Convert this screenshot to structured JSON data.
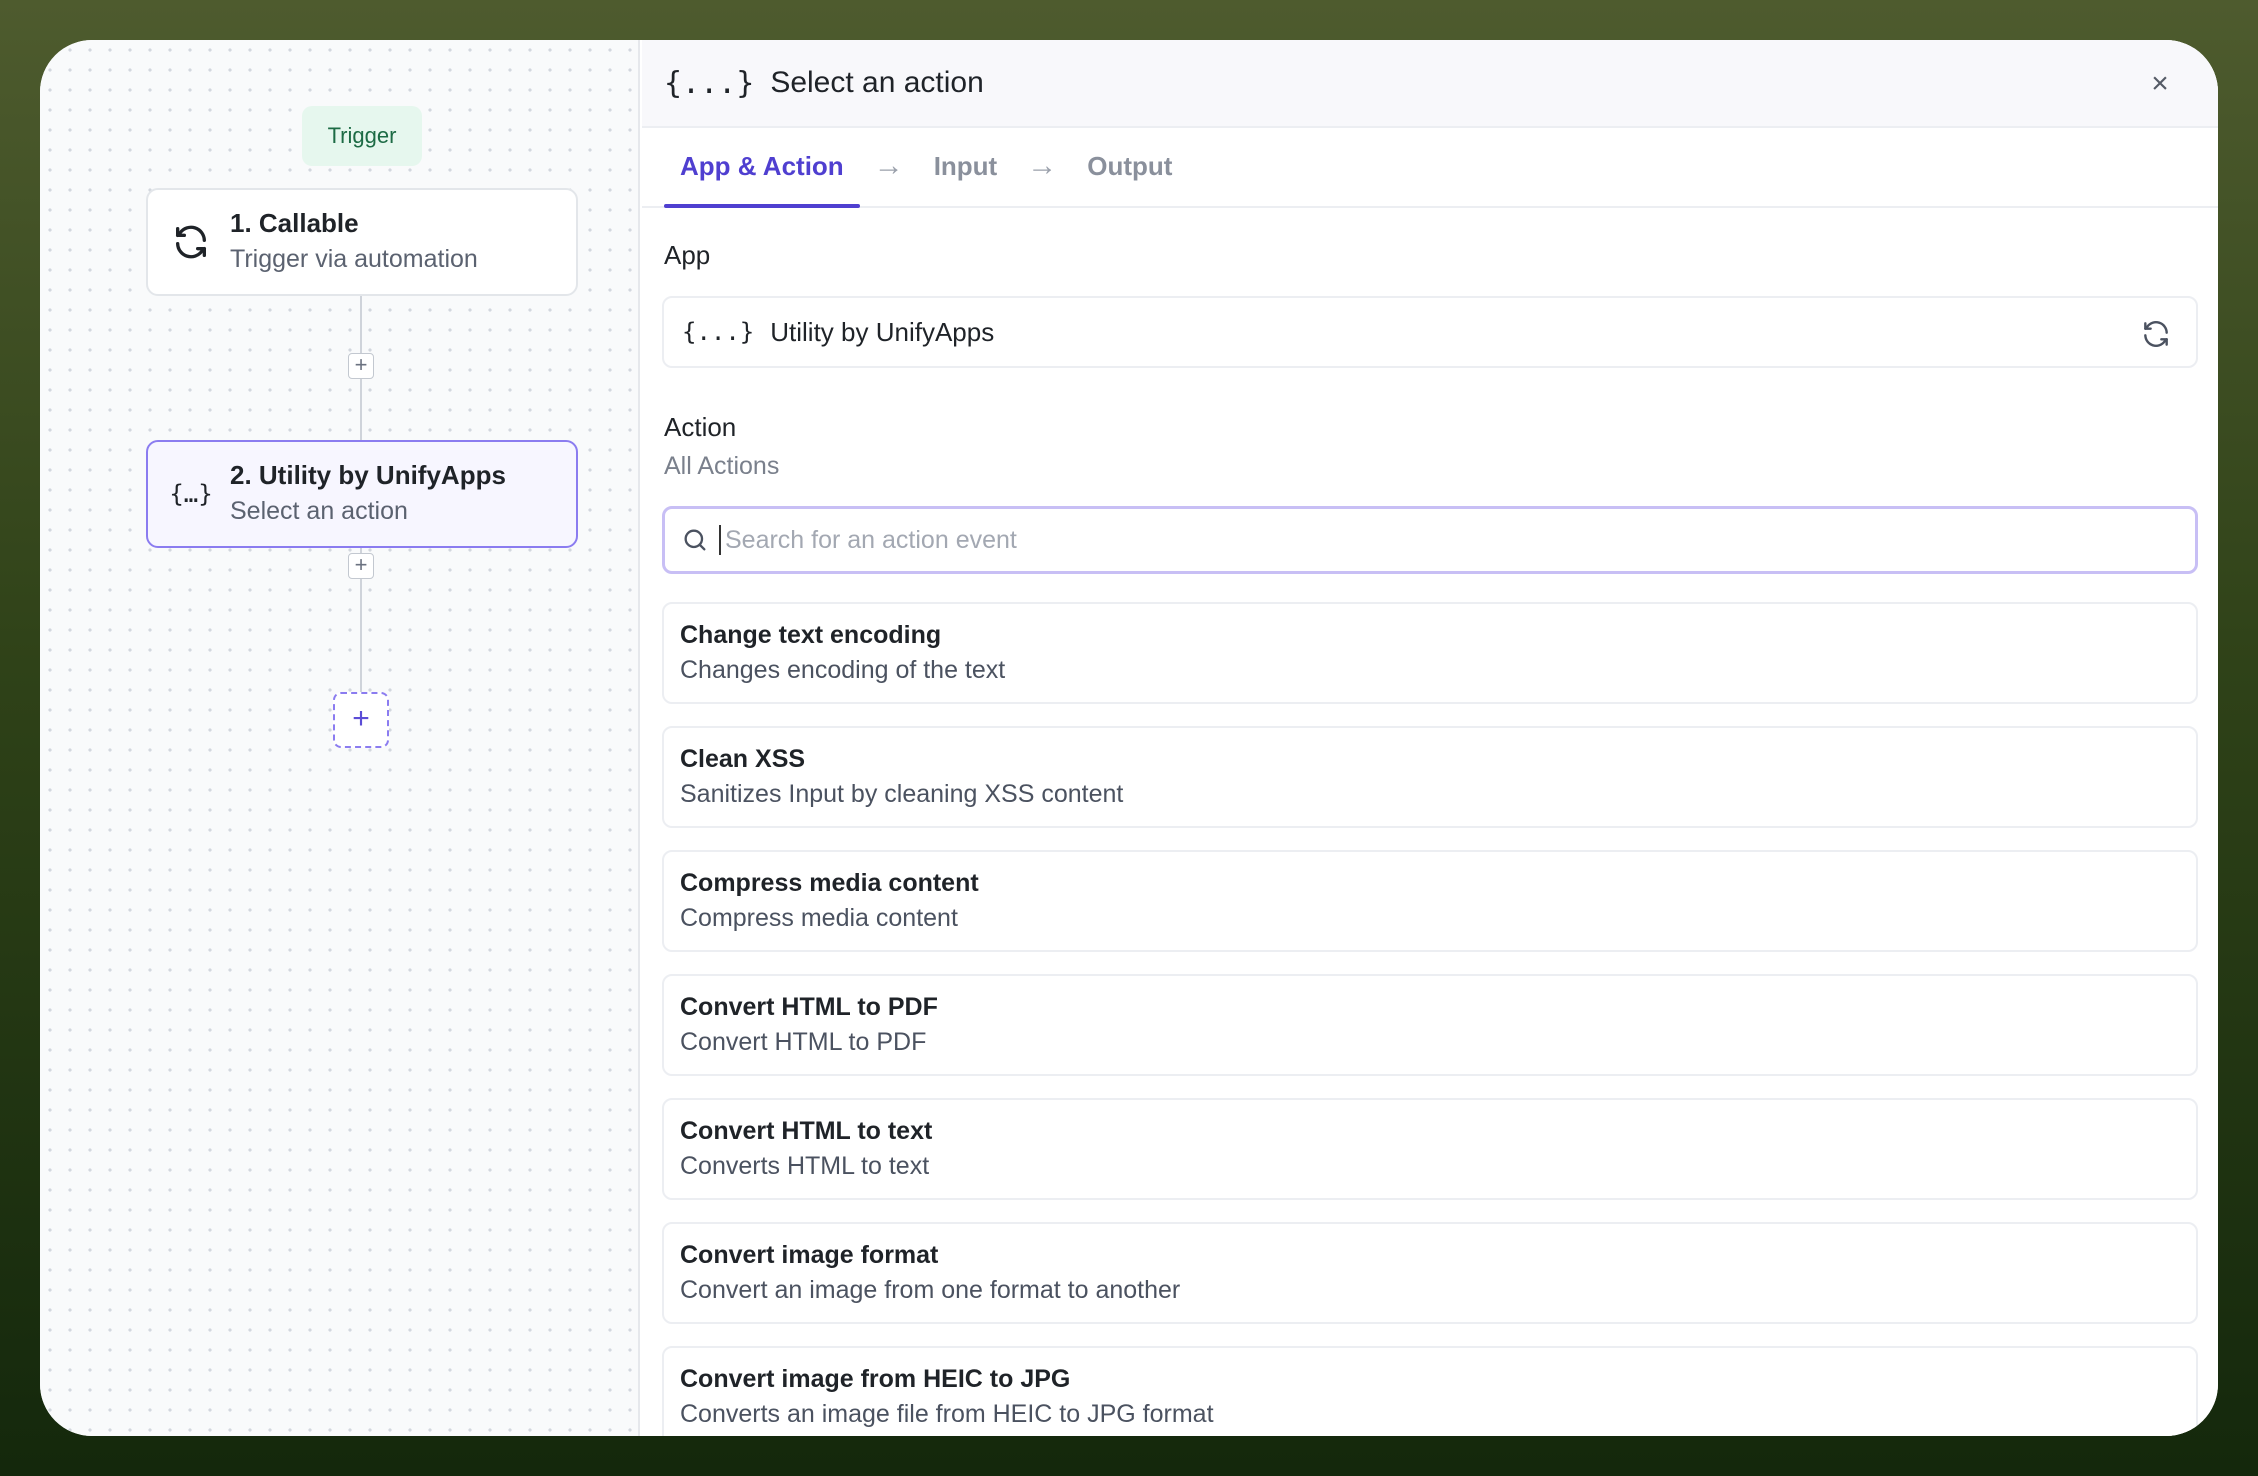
{
  "canvas": {
    "trigger_label": "Trigger",
    "nodes": [
      {
        "title": "1. Callable",
        "subtitle": "Trigger via automation",
        "icon": "sync-icon"
      },
      {
        "title": "2. Utility by UnifyApps",
        "subtitle": "Select an action",
        "icon": "braces-icon"
      }
    ],
    "add_step_symbol": "+"
  },
  "panel": {
    "icon_text": "{...}",
    "title": "Select an action",
    "close_symbol": "×",
    "tabs": [
      {
        "label": "App & Action",
        "active": true
      },
      {
        "label": "Input",
        "active": false
      },
      {
        "label": "Output",
        "active": false
      }
    ],
    "tab_arrow": "→",
    "app_label": "App",
    "app_icon_text": "{...}",
    "app_name": "Utility by UnifyApps",
    "action_label": "Action",
    "action_sub": "All Actions",
    "search_placeholder": "Search for an action event",
    "actions": [
      {
        "title": "Change text encoding",
        "desc": "Changes encoding of the text"
      },
      {
        "title": "Clean XSS",
        "desc": "Sanitizes Input by cleaning XSS content"
      },
      {
        "title": "Compress media content",
        "desc": "Compress media content"
      },
      {
        "title": "Convert HTML to PDF",
        "desc": "Convert HTML to PDF"
      },
      {
        "title": "Convert HTML to text",
        "desc": "Converts HTML to text"
      },
      {
        "title": "Convert image format",
        "desc": "Convert an image from one format to another"
      },
      {
        "title": "Convert image from HEIC to JPG",
        "desc": "Converts an image file from HEIC to JPG format"
      }
    ]
  },
  "colors": {
    "accent": "#4f3fd0",
    "trigger_bg": "#e6f7ee",
    "trigger_text": "#1d6b45"
  }
}
